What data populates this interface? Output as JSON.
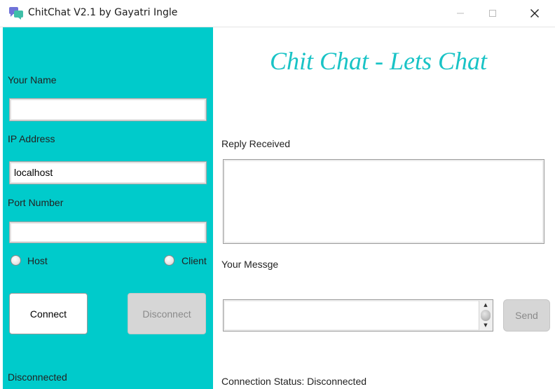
{
  "window": {
    "title": "ChitChat V2.1 by Gayatri Ingle",
    "minimize_glyph": "—",
    "maximize_glyph": "☐",
    "close_glyph": "✕"
  },
  "left": {
    "name_label": "Your Name",
    "name_value": "",
    "ip_label": "IP Address",
    "ip_value": "localhost",
    "port_label": "Port Number",
    "port_value": "",
    "host_label": "Host",
    "client_label": "Client",
    "connect_label": "Connect",
    "disconnect_label": "Disconnect",
    "status": "Disconnected"
  },
  "right": {
    "heading": "Chit Chat - Lets Chat",
    "reply_label": "Reply Received",
    "message_label": "Your Messge",
    "send_label": "Send",
    "connection_status": "Connection Status: Disconnected"
  },
  "colors": {
    "panel": "#00cbcb",
    "heading": "#19c3c6"
  }
}
